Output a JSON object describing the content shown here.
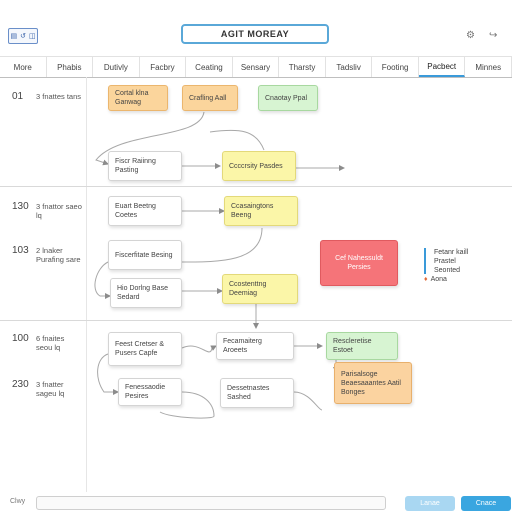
{
  "header": {
    "view_buttons": [
      "▤",
      "↺",
      "◫"
    ],
    "title": "AGIT MOREAY",
    "icons": [
      "settings-icon",
      "share-icon"
    ]
  },
  "tabs": [
    "More",
    "Phabis",
    "Dutivly",
    "Facbry",
    "Ceating",
    "Sensary",
    "Tharsty",
    "Tadsliv",
    "Footing",
    "Pacbect",
    "Minnes"
  ],
  "lanes": [
    {
      "num": "01",
      "text": "3 fnattes tans"
    },
    {
      "num": "130",
      "text": "3 fnattor saeo lq"
    },
    {
      "num": "103",
      "text": "2 lnaker Purafing sare"
    },
    {
      "num": "100",
      "text": "6 fnaites seou lq"
    },
    {
      "num": "230",
      "text": "3 fnatter sageu lq"
    }
  ],
  "cards": {
    "c1": "Cortal klna Ganwag",
    "c2": "Crafling Aall",
    "c3": "Cnaotay Ppal",
    "c4": "Fiscr Raiinng Pasting",
    "c5": "Ccccrsity Pasdes",
    "c6": "Euart Beetng Coetes",
    "c7": "Ccasaingtons Beeng",
    "c8": "Fiscerfitate Besing",
    "c9": "Hio Dorlng Base Sedard",
    "c10": "Ccostenttng Deemiag",
    "c11": "Cef Nahessuldt Persies",
    "c12": "Feest Cretser & Pusers Capfe",
    "c13": "Fecamaiterg Aroeets",
    "c14": "Rescleretise Estoet",
    "c15": "Fenessaodie Pesires",
    "c16": "Dessetnastes Sashed",
    "c17": "Parisalsoge Beaesaaantes Aatil Bonges"
  },
  "legend": {
    "line1": "Fetanr kaill",
    "line2": "Prastel",
    "line3": "Seonted",
    "line4": "Aona"
  },
  "footer": {
    "label": "Clwy",
    "input_value": "",
    "btn1": "Lanae",
    "btn2": "Cnace"
  }
}
